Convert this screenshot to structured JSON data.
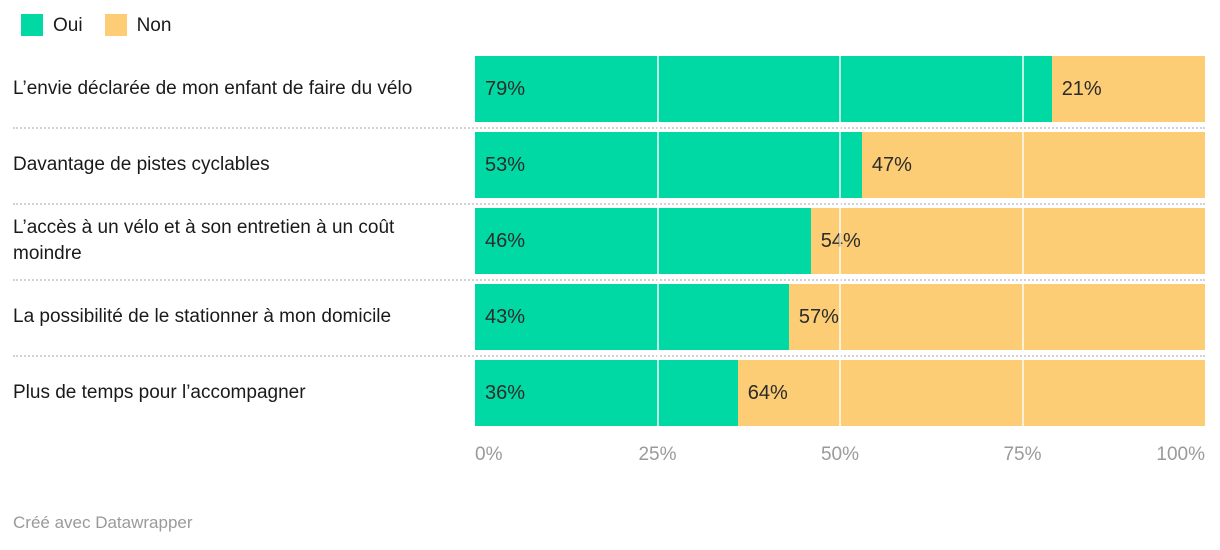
{
  "legend": {
    "items": [
      {
        "label": "Oui",
        "color": "#00d9a3",
        "icon": "legend-swatch-oui"
      },
      {
        "label": "Non",
        "color": "#fccd74",
        "icon": "legend-swatch-non"
      }
    ]
  },
  "footer": {
    "credit": "Créé avec Datawrapper"
  },
  "chart_data": {
    "type": "bar",
    "orientation": "horizontal",
    "stacked": true,
    "stack_total": 100,
    "title": "",
    "subtitle": "",
    "xlabel": "",
    "ylabel": "",
    "xlim": [
      0,
      100
    ],
    "grid": true,
    "legend_position": "top-left",
    "value_suffix": "%",
    "categories": [
      "L’envie déclarée de mon enfant de faire du vélo",
      "Davantage de pistes cyclables",
      "L’accès à un vélo et à son entretien à un coût moindre",
      "La possibilité de le stationner à mon domicile",
      "Plus de temps pour l’accompagner"
    ],
    "series": [
      {
        "name": "Oui",
        "color": "#00d9a3",
        "values": [
          79,
          53,
          46,
          43,
          36
        ]
      },
      {
        "name": "Non",
        "color": "#fccd74",
        "values": [
          21,
          47,
          54,
          57,
          64
        ]
      }
    ],
    "value_labels": [
      [
        "79%",
        "21%"
      ],
      [
        "53%",
        "47%"
      ],
      [
        "46%",
        "54%"
      ],
      [
        "43%",
        "57%"
      ],
      [
        "36%",
        "64%"
      ]
    ],
    "xticks": [
      0,
      25,
      50,
      75,
      100
    ],
    "xticklabels": [
      "0%",
      "25%",
      "50%",
      "75%",
      "100%"
    ]
  }
}
